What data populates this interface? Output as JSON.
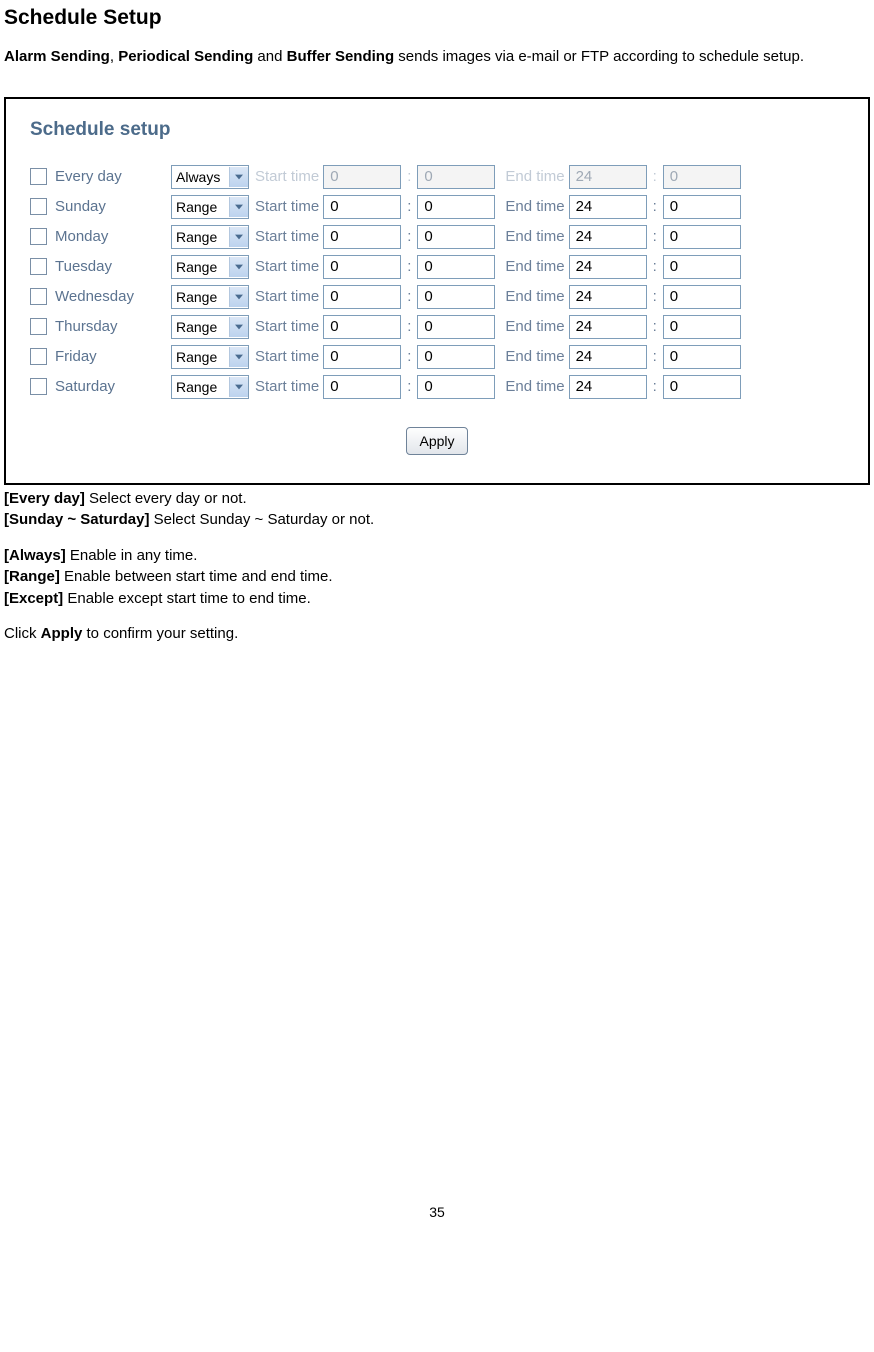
{
  "doc": {
    "title": "Schedule Setup",
    "intro_parts": {
      "b1": "Alarm Sending",
      "t1": ", ",
      "b2": "Periodical Sending",
      "t2": " and ",
      "b3": "Buffer Sending",
      "t3": " sends images via e-mail or FTP according to schedule setup."
    },
    "panel_title": "Schedule setup",
    "labels": {
      "start": "Start time",
      "end": "End time",
      "apply": "Apply"
    },
    "rows": [
      {
        "day": "Every day",
        "mode": "Always",
        "sh": "0",
        "sm": "0",
        "eh": "24",
        "em": "0",
        "disabled": true
      },
      {
        "day": "Sunday",
        "mode": "Range",
        "sh": "0",
        "sm": "0",
        "eh": "24",
        "em": "0",
        "disabled": false
      },
      {
        "day": "Monday",
        "mode": "Range",
        "sh": "0",
        "sm": "0",
        "eh": "24",
        "em": "0",
        "disabled": false
      },
      {
        "day": "Tuesday",
        "mode": "Range",
        "sh": "0",
        "sm": "0",
        "eh": "24",
        "em": "0",
        "disabled": false
      },
      {
        "day": "Wednesday",
        "mode": "Range",
        "sh": "0",
        "sm": "0",
        "eh": "24",
        "em": "0",
        "disabled": false
      },
      {
        "day": "Thursday",
        "mode": "Range",
        "sh": "0",
        "sm": "0",
        "eh": "24",
        "em": "0",
        "disabled": false
      },
      {
        "day": "Friday",
        "mode": "Range",
        "sh": "0",
        "sm": "0",
        "eh": "24",
        "em": "0",
        "disabled": false
      },
      {
        "day": "Saturday",
        "mode": "Range",
        "sh": "0",
        "sm": "0",
        "eh": "24",
        "em": "0",
        "disabled": false
      }
    ],
    "defs": {
      "l1b": "[Every day]",
      "l1t": " Select every day or not.",
      "l2b": "[Sunday ~ Saturday]",
      "l2t": " Select Sunday ~ Saturday or not.",
      "l3b": "[Always]",
      "l3t": " Enable in any time.",
      "l4b": "[Range]",
      "l4t": " Enable between start time and end time.",
      "l5b": "[Except]",
      "l5t": " Enable except start time to end time.",
      "l6a": "Click ",
      "l6b": "Apply",
      "l6c": " to confirm your setting."
    },
    "page_number": "35"
  }
}
